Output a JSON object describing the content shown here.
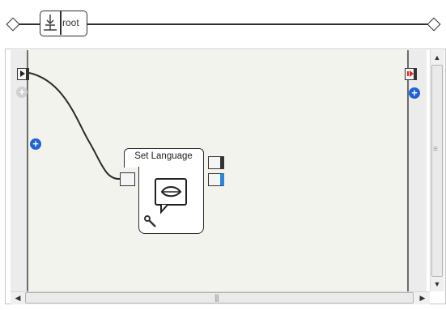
{
  "timeline": {
    "root_label": "root"
  },
  "box": {
    "title": "Set Language"
  },
  "icons": {
    "behavior_input": "play-icon",
    "behavior_output": "stop-icon",
    "box_icon": "speech-lips-icon",
    "settings": "wrench-icon",
    "add_input": "plus-icon",
    "add_output": "plus-icon"
  },
  "colors": {
    "accent": "#1f63d8",
    "output_stop": "#d9272e",
    "output_signal": "#2a86d8"
  }
}
